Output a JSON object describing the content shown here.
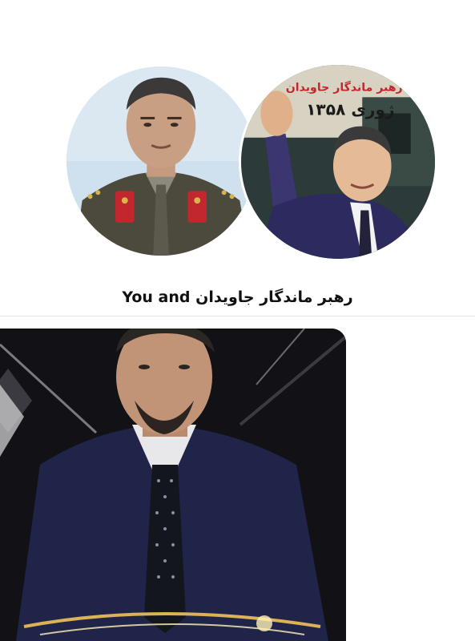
{
  "conversation": {
    "caption": "رهبر ماندگار جاویدان You and",
    "participants": [
      {
        "avatar": "military-officer-avatar"
      },
      {
        "avatar": "waving-leader-avatar"
      }
    ]
  },
  "avatar_right_overlay": {
    "line1": "رهبر ماندگار جاویدان",
    "line2": "۱۳۵۸ ژوری"
  },
  "colors": {
    "background": "#ffffff",
    "caption_text": "#111111",
    "divider": "#e6e6e6"
  }
}
